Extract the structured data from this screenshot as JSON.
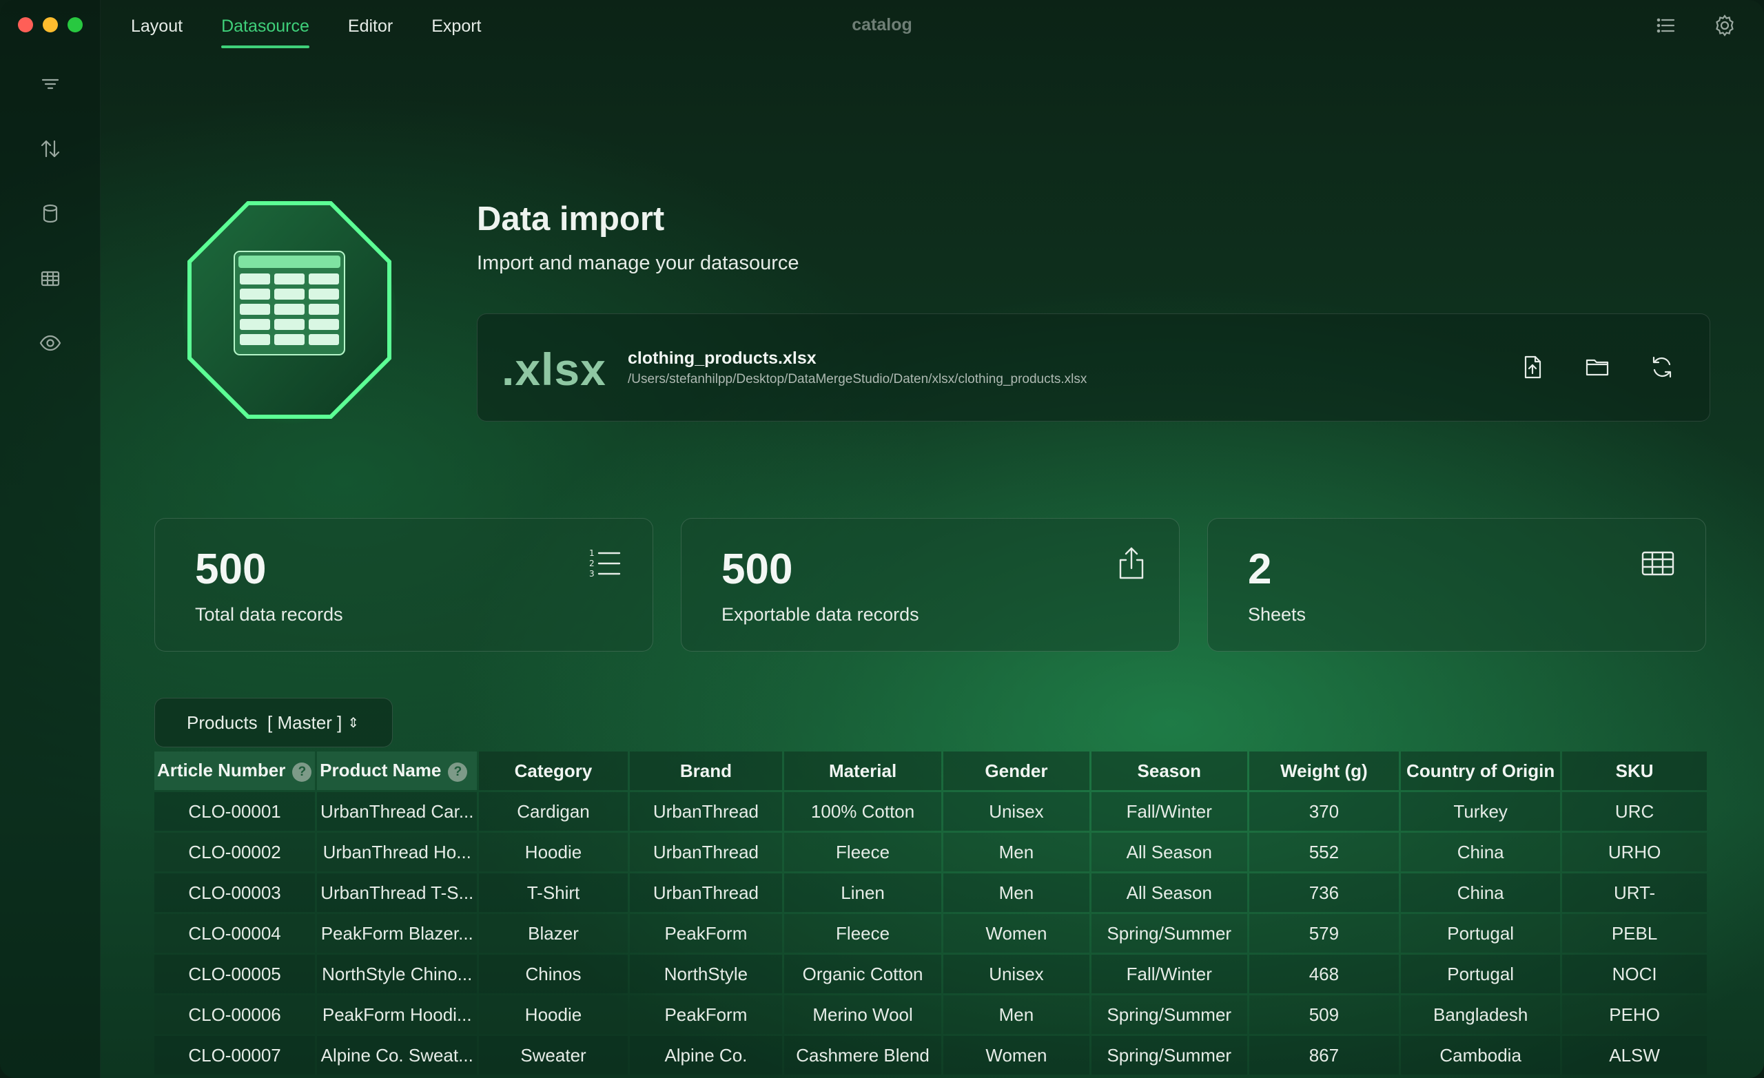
{
  "app": {
    "title": "catalog"
  },
  "nav": {
    "tabs": [
      "Layout",
      "Datasource",
      "Editor",
      "Export"
    ],
    "active": "Datasource"
  },
  "header": {
    "title": "Data import",
    "subtitle": "Import and manage your datasource"
  },
  "file": {
    "extension": ".xlsx",
    "name": "clothing_products.xlsx",
    "path": "/Users/stefanhilpp/Desktop/DataMergeStudio/Daten/xlsx/clothing_products.xlsx"
  },
  "stats": [
    {
      "value": "500",
      "label": "Total data records",
      "icon": "numbered-list-icon"
    },
    {
      "value": "500",
      "label": "Exportable data records",
      "icon": "share-icon"
    },
    {
      "value": "2",
      "label": "Sheets",
      "icon": "table-icon"
    }
  ],
  "sheet_select": {
    "label": "Products  [ Master ]"
  },
  "table": {
    "columns": [
      "Article Number",
      "Product Name",
      "Category",
      "Brand",
      "Material",
      "Gender",
      "Season",
      "Weight (g)",
      "Country of Origin",
      "SKU"
    ],
    "key_marker": "?",
    "rows": [
      [
        "CLO-00001",
        "UrbanThread Car...",
        "Cardigan",
        "UrbanThread",
        "100% Cotton",
        "Unisex",
        "Fall/Winter",
        "370",
        "Turkey",
        "URC"
      ],
      [
        "CLO-00002",
        "UrbanThread Ho...",
        "Hoodie",
        "UrbanThread",
        "Fleece",
        "Men",
        "All Season",
        "552",
        "China",
        "URHO"
      ],
      [
        "CLO-00003",
        "UrbanThread T-S...",
        "T-Shirt",
        "UrbanThread",
        "Linen",
        "Men",
        "All Season",
        "736",
        "China",
        "URT-"
      ],
      [
        "CLO-00004",
        "PeakForm Blazer...",
        "Blazer",
        "PeakForm",
        "Fleece",
        "Women",
        "Spring/Summer",
        "579",
        "Portugal",
        "PEBL"
      ],
      [
        "CLO-00005",
        "NorthStyle Chino...",
        "Chinos",
        "NorthStyle",
        "Organic Cotton",
        "Unisex",
        "Fall/Winter",
        "468",
        "Portugal",
        "NOCI"
      ],
      [
        "CLO-00006",
        "PeakForm Hoodi...",
        "Hoodie",
        "PeakForm",
        "Merino Wool",
        "Men",
        "Spring/Summer",
        "509",
        "Bangladesh",
        "PEHO"
      ],
      [
        "CLO-00007",
        "Alpine Co. Sweat...",
        "Sweater",
        "Alpine Co.",
        "Cashmere Blend",
        "Women",
        "Spring/Summer",
        "867",
        "Cambodia",
        "ALSW"
      ]
    ]
  },
  "colors": {
    "accent": "#3fd07a",
    "background": "#0f3520"
  }
}
